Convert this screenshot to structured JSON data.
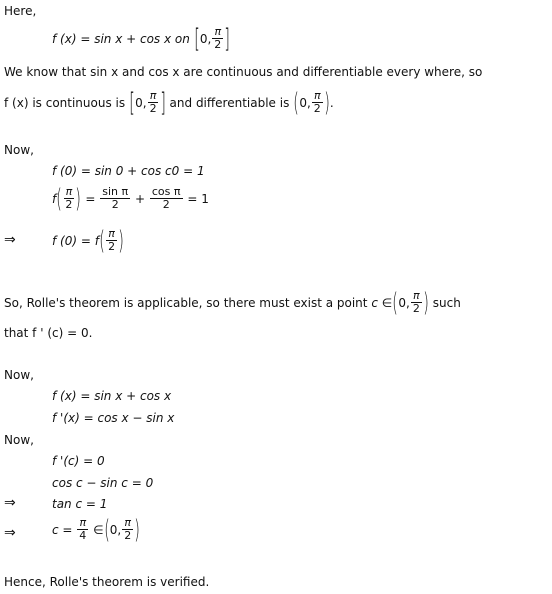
{
  "lines": {
    "here": "Here,",
    "def_lhs": "f (x) = sin x + cos x  on",
    "def_interval_left": "0,",
    "know_text": "We know that  sin x  and  cos x  are continuous and differentiable every where, so",
    "cont_a": "f (x)  is continuous is",
    "cont_b": "and differentiable is",
    "now1": "Now,",
    "f0": "f (0) = sin 0 + cos c0 = 1",
    "fpi_lhs": "f",
    "fpi_mid1": "=",
    "fpi_plus": "+",
    "fpi_eq": "= 1",
    "sin_pi": "sin π",
    "cos_pi": "cos π",
    "two": "2",
    "pi": "π",
    "zero_comma": "0,",
    "implies": "⇒",
    "f0_eq_lhs": "f (0) = f",
    "rolle_a": "So, Rolle's theorem is applicable, so there must exist a point",
    "rolle_c": "c ∈",
    "rolle_b": "such",
    "rolle_line2": "that f ' (c) = 0.",
    "now2": "Now,",
    "fx": "f (x) = sin x + cos x",
    "fpx": "f '(x) = cos x − sin x",
    "now3": "Now,",
    "fpc": "f '(c) = 0",
    "cosc": "cos c − sin c = 0",
    "tanc": "tan c = 1",
    "c_eq": "c =",
    "four": "4",
    "in_sym": "∈",
    "hence": "Hence, Rolle's theorem is verified."
  }
}
